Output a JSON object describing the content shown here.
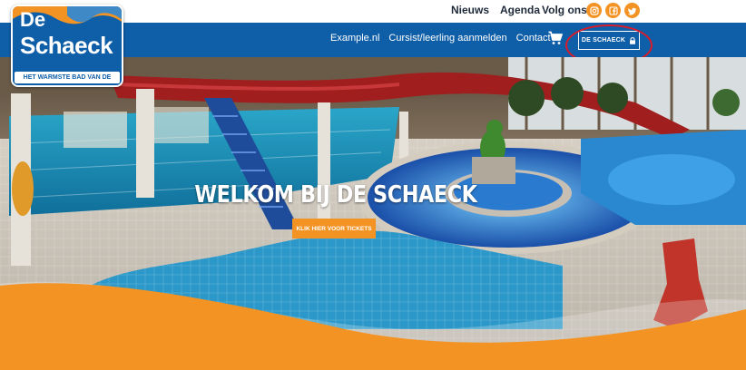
{
  "top_menu": {
    "news": "Nieuws",
    "agenda": "Agenda",
    "follow_label": "Volg ons:",
    "social_icons": [
      "instagram-icon",
      "facebook-icon",
      "twitter-icon"
    ]
  },
  "logo": {
    "line1": "De",
    "line2": "Schaeck",
    "tagline": "HET WARMSTE BAD VAN DE REGIO"
  },
  "nav": {
    "items": [
      {
        "label": "Example.nl"
      },
      {
        "label": "Cursist/leerling aanmelden"
      },
      {
        "label": "Contact"
      }
    ],
    "cart_icon": "cart-icon",
    "login_label": "DE SCHAECK",
    "login_icon": "lock-icon"
  },
  "hero": {
    "title": "WELKOM BIJ DE SCHAECK",
    "cta_label": "KLIK HIER VOOR TICKETS"
  },
  "colors": {
    "brand_blue": "#0f5ea8",
    "accent_orange": "#f39324",
    "highlight_red": "#d91b2a"
  }
}
